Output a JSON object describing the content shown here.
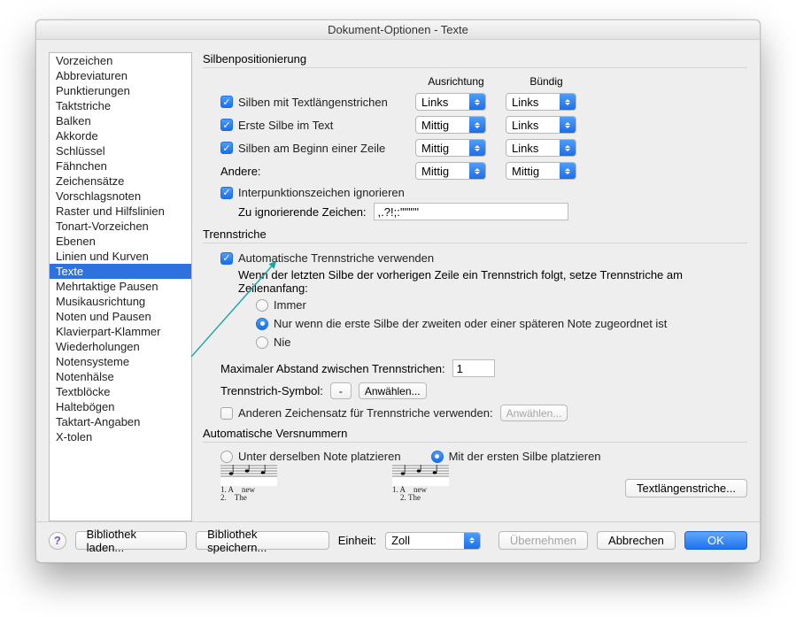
{
  "title": "Dokument-Optionen - Texte",
  "sidebar": {
    "selected_index": 14,
    "items": [
      "Vorzeichen",
      "Abbreviaturen",
      "Punktierungen",
      "Taktstriche",
      "Balken",
      "Akkorde",
      "Schlüssel",
      "Fähnchen",
      "Zeichensätze",
      "Vorschlagsnoten",
      "Raster und Hilfslinien",
      "Tonart-Vorzeichen",
      "Ebenen",
      "Linien und Kurven",
      "Texte",
      "Mehrtaktige Pausen",
      "Musikausrichtung",
      "Noten und Pausen",
      "Klavierpart-Klammer",
      "Wiederholungen",
      "Notensysteme",
      "Notenhälse",
      "Textblöcke",
      "Haltebögen",
      "Taktart-Angaben",
      "X-tolen"
    ]
  },
  "pos": {
    "title": "Silbenpositionierung",
    "col_ausrichtung": "Ausrichtung",
    "col_buendig": "Bündig",
    "r1": {
      "label": "Silben mit Textlängenstrichen",
      "checked": true,
      "ausrichtung": "Links",
      "buendig": "Links"
    },
    "r2": {
      "label": "Erste Silbe im Text",
      "checked": true,
      "ausrichtung": "Mittig",
      "buendig": "Links"
    },
    "r3": {
      "label": "Silben am Beginn einer Zeile",
      "checked": true,
      "ausrichtung": "Mittig",
      "buendig": "Links"
    },
    "andere_label": "Andere:",
    "andere": {
      "ausrichtung": "Mittig",
      "buendig": "Mittig"
    },
    "ignore_punct": {
      "checked": true,
      "label": "Interpunktionszeichen ignorieren"
    },
    "ignore_chars_label": "Zu ignorierende Zeichen:",
    "ignore_chars_value": ",.?!;:'\"\"\"''"
  },
  "hyphen": {
    "title": "Trennstriche",
    "auto": {
      "checked": true,
      "label": "Automatische Trennstriche verwenden"
    },
    "follow_text": "Wenn der letzten Silbe der vorherigen Zeile ein Trennstrich folgt, setze Trennstriche am Zeilenanfang:",
    "opts": {
      "immer": "Immer",
      "nurwenn": "Nur wenn die erste Silbe der zweiten oder einer späteren Note zugeordnet ist",
      "nie": "Nie",
      "selected": "nurwenn"
    },
    "maxdist_label": "Maximaler Abstand zwischen Trennstrichen:",
    "maxdist_value": "1",
    "symbol_label": "Trennstrich-Symbol:",
    "symbol_value": "-",
    "anwaehlen": "Anwählen...",
    "otherfont": {
      "checked": false,
      "label": "Anderen Zeichensatz für Trennstriche verwenden:"
    },
    "anwaehlen_disabled": "Anwählen..."
  },
  "verse": {
    "title": "Automatische Versnummern",
    "opt_same": "Unter derselben Note platzieren",
    "opt_first": "Mit der ersten Silbe platzieren",
    "selected": "first",
    "cap1_a": "1. A",
    "cap1_b": "new",
    "cap2_a": "2.",
    "cap2_b": "The",
    "btn": "Textlängenstriche..."
  },
  "footer": {
    "load": "Bibliothek laden...",
    "save": "Bibliothek speichern...",
    "unit_label": "Einheit:",
    "unit_value": "Zoll",
    "apply": "Übernehmen",
    "cancel": "Abbrechen",
    "ok": "OK"
  }
}
